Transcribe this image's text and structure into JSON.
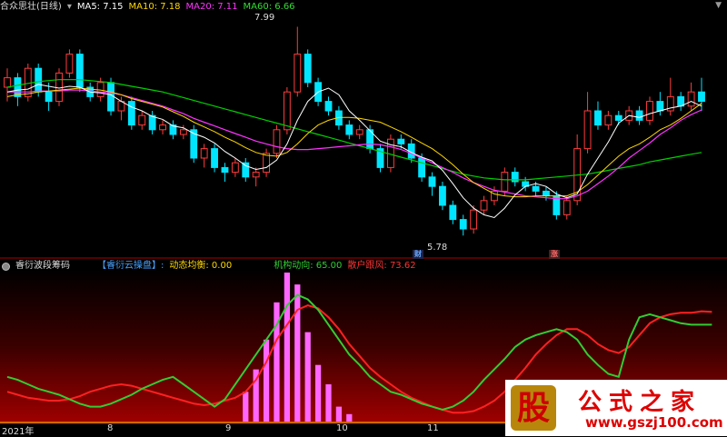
{
  "main_header": {
    "title": "合众思壮(日线)",
    "ma5": "MA5: 7.15",
    "ma10": "MA10: 7.18",
    "ma20": "MA20: 7.11",
    "ma60": "MA60: 6.66"
  },
  "annotations": {
    "high_price": "7.99",
    "low_price": "5.78",
    "tag_cai": "财",
    "tag_zhang": "涨"
  },
  "indicator_header": {
    "title": "睿衍波段筹码",
    "tag": "【睿衍云操盘】:",
    "dyn": "动态均衡: 0.00",
    "inst": "机构动向: 65.00",
    "retail": "散户跟风: 73.62"
  },
  "x_axis": [
    "2021年",
    "8",
    "9",
    "10",
    "11"
  ],
  "watermark": {
    "glyph": "股",
    "title": "公式之家",
    "url": "www.gszj100.com"
  },
  "colors": {
    "up": "#ff3c3c",
    "down": "#00e5ff",
    "ma5": "#ffffff",
    "ma10": "#ffd700",
    "ma20": "#ff33ff",
    "ma60": "#00d000",
    "inst": "#33cc33",
    "retail": "#ff2020",
    "bars": "#ff66ff"
  },
  "chart_data": {
    "type": "candlestick",
    "price_range": [
      5.6,
      8.1
    ],
    "candles": [
      [
        7.35,
        7.45,
        7.2,
        7.55
      ],
      [
        7.45,
        7.25,
        7.15,
        7.5
      ],
      [
        7.25,
        7.55,
        7.2,
        7.6
      ],
      [
        7.55,
        7.3,
        7.25,
        7.6
      ],
      [
        7.3,
        7.2,
        7.1,
        7.4
      ],
      [
        7.2,
        7.5,
        7.15,
        7.55
      ],
      [
        7.5,
        7.7,
        7.45,
        7.75
      ],
      [
        7.7,
        7.35,
        7.3,
        7.75
      ],
      [
        7.35,
        7.25,
        7.2,
        7.4
      ],
      [
        7.25,
        7.4,
        7.2,
        7.45
      ],
      [
        7.4,
        7.1,
        7.05,
        7.45
      ],
      [
        7.1,
        7.2,
        7.0,
        7.25
      ],
      [
        7.2,
        6.95,
        6.9,
        7.25
      ],
      [
        6.95,
        7.05,
        6.9,
        7.1
      ],
      [
        7.05,
        6.9,
        6.85,
        7.1
      ],
      [
        6.9,
        6.95,
        6.85,
        7.0
      ],
      [
        6.95,
        6.85,
        6.8,
        7.0
      ],
      [
        6.85,
        6.9,
        6.8,
        6.95
      ],
      [
        6.9,
        6.6,
        6.55,
        6.95
      ],
      [
        6.6,
        6.7,
        6.5,
        6.75
      ],
      [
        6.7,
        6.5,
        6.45,
        6.75
      ],
      [
        6.5,
        6.45,
        6.35,
        6.55
      ],
      [
        6.45,
        6.55,
        6.4,
        6.6
      ],
      [
        6.55,
        6.4,
        6.35,
        6.6
      ],
      [
        6.4,
        6.45,
        6.3,
        6.5
      ],
      [
        6.45,
        6.65,
        6.4,
        6.7
      ],
      [
        6.65,
        6.9,
        6.6,
        6.95
      ],
      [
        6.9,
        7.3,
        6.85,
        7.35
      ],
      [
        7.3,
        7.7,
        7.25,
        7.99
      ],
      [
        7.7,
        7.4,
        7.35,
        7.75
      ],
      [
        7.4,
        7.2,
        7.15,
        7.45
      ],
      [
        7.2,
        7.1,
        7.05,
        7.25
      ],
      [
        7.1,
        6.95,
        6.9,
        7.15
      ],
      [
        6.95,
        6.85,
        6.8,
        7.0
      ],
      [
        6.85,
        6.9,
        6.8,
        6.95
      ],
      [
        6.9,
        6.7,
        6.65,
        6.95
      ],
      [
        6.7,
        6.5,
        6.45,
        6.75
      ],
      [
        6.5,
        6.8,
        6.45,
        6.85
      ],
      [
        6.8,
        6.75,
        6.7,
        6.85
      ],
      [
        6.75,
        6.6,
        6.55,
        6.8
      ],
      [
        6.6,
        6.4,
        6.35,
        6.65
      ],
      [
        6.4,
        6.3,
        6.2,
        6.45
      ],
      [
        6.3,
        6.1,
        6.05,
        6.35
      ],
      [
        6.1,
        5.95,
        5.9,
        6.15
      ],
      [
        5.95,
        5.85,
        5.78,
        6.0
      ],
      [
        5.85,
        6.05,
        5.8,
        6.1
      ],
      [
        6.05,
        6.15,
        6.0,
        6.2
      ],
      [
        6.15,
        6.25,
        6.1,
        6.3
      ],
      [
        6.25,
        6.45,
        6.2,
        6.5
      ],
      [
        6.45,
        6.35,
        6.3,
        6.5
      ],
      [
        6.35,
        6.3,
        6.25,
        6.4
      ],
      [
        6.3,
        6.25,
        6.2,
        6.35
      ],
      [
        6.25,
        6.2,
        6.15,
        6.3
      ],
      [
        6.2,
        6.0,
        5.95,
        6.25
      ],
      [
        6.0,
        6.15,
        5.95,
        6.2
      ],
      [
        6.15,
        6.7,
        6.1,
        6.85
      ],
      [
        6.7,
        7.1,
        6.65,
        7.3
      ],
      [
        7.1,
        6.95,
        6.9,
        7.2
      ],
      [
        6.95,
        7.05,
        6.9,
        7.1
      ],
      [
        7.05,
        7.0,
        6.95,
        7.1
      ],
      [
        7.0,
        7.1,
        6.95,
        7.15
      ],
      [
        7.1,
        7.0,
        6.95,
        7.15
      ],
      [
        7.0,
        7.2,
        6.95,
        7.25
      ],
      [
        7.2,
        7.1,
        7.05,
        7.3
      ],
      [
        7.1,
        7.25,
        7.05,
        7.45
      ],
      [
        7.25,
        7.15,
        7.1,
        7.3
      ],
      [
        7.15,
        7.3,
        7.1,
        7.4
      ],
      [
        7.3,
        7.2,
        7.1,
        7.45
      ]
    ],
    "ma5": [
      7.3,
      7.32,
      7.33,
      7.38,
      7.36,
      7.34,
      7.36,
      7.35,
      7.3,
      7.29,
      7.27,
      7.2,
      7.14,
      7.1,
      7.04,
      7.01,
      6.94,
      6.92,
      6.86,
      6.82,
      6.76,
      6.67,
      6.6,
      6.52,
      6.48,
      6.5,
      6.58,
      6.75,
      7.0,
      7.2,
      7.3,
      7.34,
      7.27,
      7.1,
      7.0,
      6.89,
      6.78,
      6.74,
      6.72,
      6.66,
      6.61,
      6.57,
      6.47,
      6.33,
      6.18,
      6.07,
      6.0,
      5.97,
      6.07,
      6.21,
      6.3,
      6.33,
      6.3,
      6.22,
      6.18,
      6.22,
      6.43,
      6.6,
      6.77,
      6.97,
      7.05,
      7.03,
      7.07,
      7.1,
      7.13,
      7.15,
      7.2,
      7.15
    ],
    "ma10": [
      7.25,
      7.27,
      7.28,
      7.3,
      7.31,
      7.32,
      7.33,
      7.34,
      7.33,
      7.32,
      7.3,
      7.27,
      7.23,
      7.2,
      7.17,
      7.14,
      7.09,
      7.04,
      6.98,
      6.93,
      6.88,
      6.82,
      6.77,
      6.71,
      6.66,
      6.63,
      6.62,
      6.66,
      6.75,
      6.86,
      6.95,
      7.0,
      7.03,
      7.03,
      7.02,
      7.0,
      6.98,
      6.93,
      6.88,
      6.82,
      6.76,
      6.7,
      6.62,
      6.53,
      6.43,
      6.34,
      6.28,
      6.22,
      6.2,
      6.19,
      6.19,
      6.2,
      6.2,
      6.2,
      6.2,
      6.24,
      6.32,
      6.42,
      6.52,
      6.62,
      6.7,
      6.75,
      6.82,
      6.9,
      6.95,
      7.02,
      7.1,
      7.18
    ],
    "ma20": [
      7.3,
      7.3,
      7.3,
      7.31,
      7.31,
      7.31,
      7.32,
      7.32,
      7.31,
      7.3,
      7.29,
      7.27,
      7.24,
      7.21,
      7.18,
      7.15,
      7.11,
      7.07,
      7.02,
      6.98,
      6.94,
      6.9,
      6.86,
      6.82,
      6.78,
      6.75,
      6.72,
      6.7,
      6.69,
      6.69,
      6.7,
      6.71,
      6.72,
      6.73,
      6.74,
      6.75,
      6.74,
      6.72,
      6.69,
      6.65,
      6.6,
      6.55,
      6.5,
      6.45,
      6.39,
      6.34,
      6.3,
      6.26,
      6.24,
      6.22,
      6.2,
      6.19,
      6.18,
      6.17,
      6.17,
      6.2,
      6.25,
      6.33,
      6.41,
      6.5,
      6.6,
      6.68,
      6.76,
      6.85,
      6.92,
      7.0,
      7.06,
      7.11
    ],
    "ma60": [
      7.35,
      7.37,
      7.39,
      7.41,
      7.42,
      7.43,
      7.43,
      7.43,
      7.42,
      7.41,
      7.4,
      7.38,
      7.36,
      7.34,
      7.32,
      7.3,
      7.27,
      7.24,
      7.21,
      7.18,
      7.15,
      7.12,
      7.09,
      7.06,
      7.03,
      7.0,
      6.97,
      6.94,
      6.91,
      6.88,
      6.85,
      6.82,
      6.79,
      6.76,
      6.73,
      6.7,
      6.67,
      6.64,
      6.61,
      6.58,
      6.55,
      6.52,
      6.49,
      6.46,
      6.43,
      6.41,
      6.39,
      6.38,
      6.37,
      6.37,
      6.37,
      6.38,
      6.39,
      6.4,
      6.41,
      6.42,
      6.43,
      6.45,
      6.47,
      6.49,
      6.51,
      6.53,
      6.56,
      6.58,
      6.6,
      6.62,
      6.64,
      6.66
    ],
    "inst_range": [
      0,
      100
    ],
    "inst": [
      30,
      28,
      25,
      22,
      20,
      18,
      15,
      12,
      10,
      10,
      12,
      15,
      18,
      22,
      25,
      28,
      30,
      25,
      20,
      15,
      10,
      15,
      25,
      35,
      45,
      55,
      65,
      78,
      85,
      82,
      75,
      65,
      55,
      45,
      38,
      30,
      25,
      20,
      18,
      15,
      12,
      10,
      8,
      10,
      14,
      20,
      28,
      35,
      42,
      50,
      55,
      58,
      60,
      62,
      60,
      55,
      45,
      38,
      32,
      30,
      55,
      70,
      72,
      70,
      68,
      66,
      65,
      65,
      65
    ],
    "retail": [
      20,
      18,
      16,
      15,
      14,
      14,
      15,
      17,
      20,
      22,
      24,
      25,
      24,
      22,
      20,
      18,
      16,
      14,
      12,
      11,
      12,
      14,
      16,
      20,
      28,
      40,
      55,
      65,
      75,
      78,
      76,
      70,
      62,
      52,
      44,
      36,
      30,
      25,
      20,
      16,
      13,
      10,
      8,
      6,
      6,
      7,
      10,
      14,
      20,
      28,
      36,
      45,
      52,
      58,
      62,
      62,
      58,
      52,
      48,
      46,
      50,
      58,
      66,
      70,
      72,
      73,
      73,
      74,
      73.62
    ],
    "bars": [
      0,
      0,
      0,
      0,
      0,
      0,
      0,
      0,
      0,
      0,
      0,
      0,
      0,
      0,
      0,
      0,
      0,
      0,
      0,
      0,
      0,
      0,
      0,
      20,
      35,
      55,
      80,
      100,
      92,
      60,
      38,
      25,
      10,
      5,
      0,
      0,
      0,
      0,
      0,
      0,
      0,
      0,
      0,
      0,
      0,
      0,
      0,
      0,
      0,
      0,
      0,
      0,
      0,
      0,
      0,
      0,
      0,
      0,
      0,
      0,
      0,
      0,
      0,
      0,
      0,
      0,
      0,
      0,
      0
    ]
  }
}
